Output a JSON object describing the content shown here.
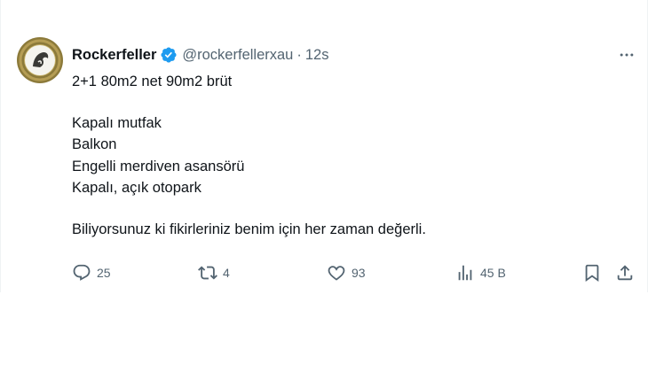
{
  "tweet": {
    "author_name": "Rockerfeller",
    "handle": "@rockerfellerxau",
    "separator": "·",
    "time": "12s",
    "verified_icon": "verified-badge-icon",
    "more_icon": "more-icon",
    "lines": [
      "2+1 80m2 net 90m2 brüt",
      "Kapalı mutfak",
      "Balkon",
      "Engelli merdiven asansörü",
      "Kapalı, açık otopark",
      "Biliyorsunuz ki fikirleriniz benim için her zaman değerli."
    ]
  },
  "actions": {
    "reply": {
      "icon": "reply-icon",
      "count": "25"
    },
    "retweet": {
      "icon": "retweet-icon",
      "count": "4"
    },
    "like": {
      "icon": "like-icon",
      "count": "93"
    },
    "views": {
      "icon": "views-icon",
      "count": "45 B"
    },
    "bookmark": {
      "icon": "bookmark-icon"
    },
    "share": {
      "icon": "share-icon"
    }
  },
  "colors": {
    "verified": "#1d9bf0",
    "secondary_text": "#536471",
    "primary_text": "#0f1419"
  }
}
